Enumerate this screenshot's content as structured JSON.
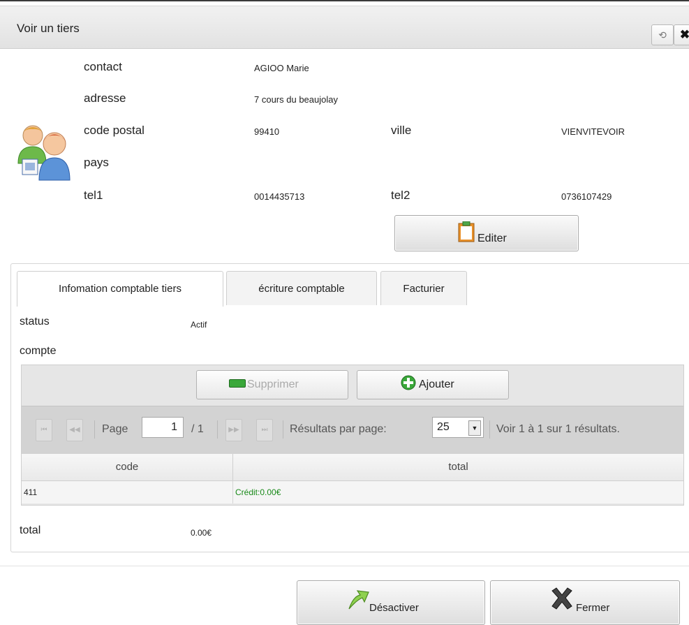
{
  "dialog": {
    "title": "Voir un tiers"
  },
  "contact": {
    "contact_label": "contact",
    "contact_value": "AGIOO Marie",
    "adresse_label": "adresse",
    "adresse_value": "7 cours du beaujolay",
    "cp_label": "code postal",
    "cp_value": "99410",
    "ville_label": "ville",
    "ville_value": "VIENVITEVOIR",
    "pays_label": "pays",
    "pays_value": "",
    "tel1_label": "tel1",
    "tel1_value": "0014435713",
    "tel2_label": "tel2",
    "tel2_value": "0736107429",
    "edit_label": "Editer"
  },
  "tabs": [
    {
      "label": "Infomation comptable tiers"
    },
    {
      "label": "écriture comptable"
    },
    {
      "label": "Facturier"
    }
  ],
  "info": {
    "status_label": "status",
    "status_value": "Actif",
    "compte_label": "compte",
    "total_label": "total",
    "total_value": "0.00€"
  },
  "grid": {
    "delete_label": "Supprimer",
    "add_label": "Ajouter",
    "page_label": "Page",
    "page_value": "1",
    "page_total": "/ 1",
    "per_page_label": "Résultats par page:",
    "per_page_value": "25",
    "summary": "Voir 1 à 1 sur 1 résultats.",
    "columns": [
      "code",
      "total"
    ],
    "rows": [
      {
        "code": "411",
        "total": "Crédit:0.00€"
      }
    ]
  },
  "footer": {
    "deactivate_label": "Désactiver",
    "close_label": "Fermer"
  },
  "colors": {
    "credit_green": "#1a8a1a",
    "accent_green": "#3aa83a"
  }
}
